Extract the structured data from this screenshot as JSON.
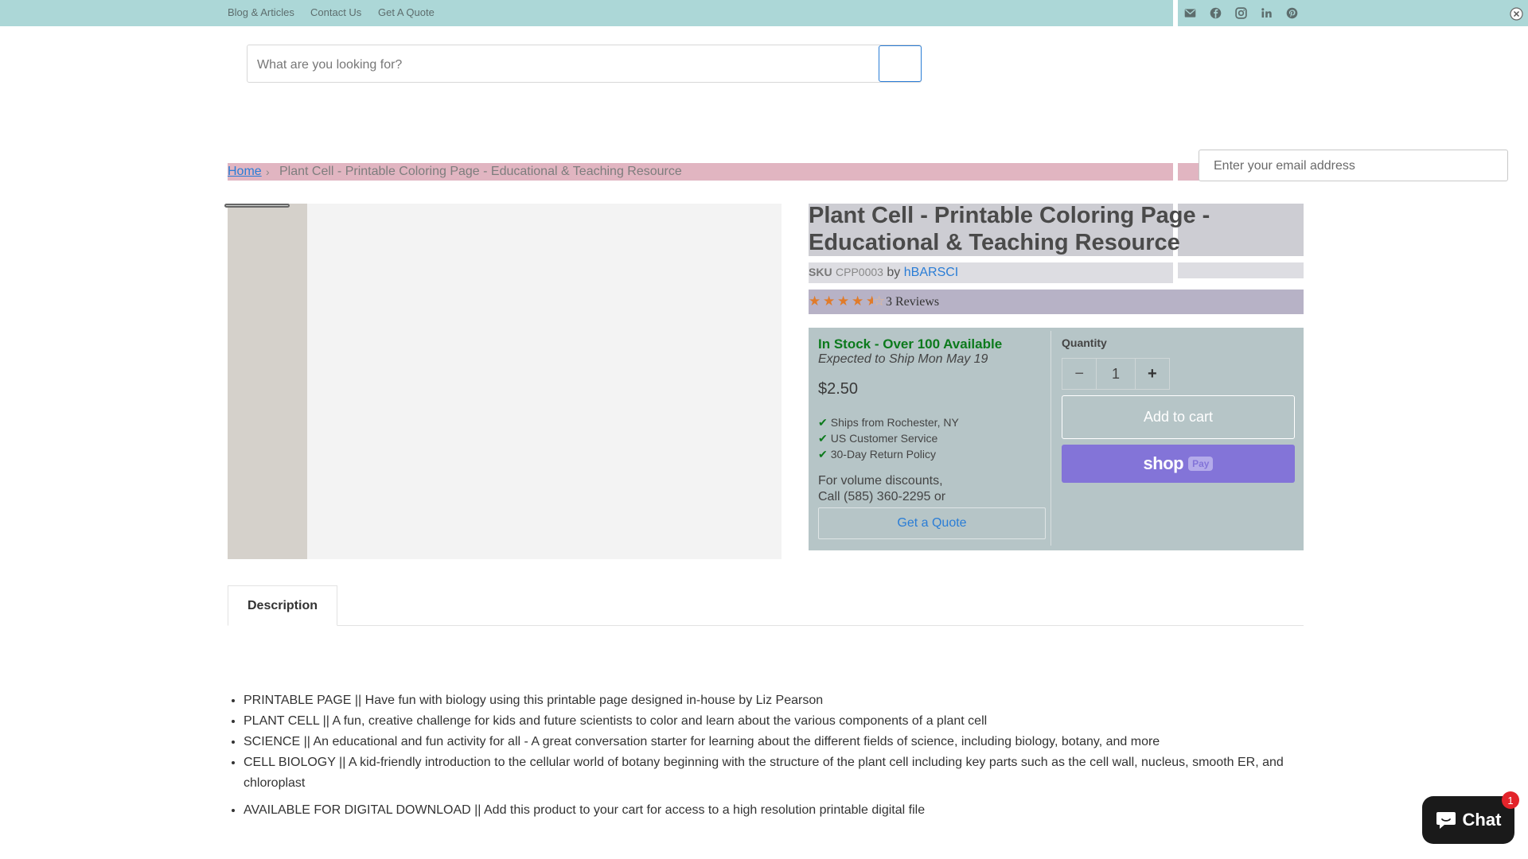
{
  "topbar": {
    "links": [
      "Blog & Articles",
      "Contact Us",
      "Get A Quote"
    ],
    "social_icons": [
      "email-icon",
      "facebook-icon",
      "instagram-icon",
      "linkedin-icon",
      "pinterest-icon"
    ]
  },
  "search": {
    "placeholder": "What are you looking for?"
  },
  "breadcrumb": {
    "home": "Home",
    "separator": "›",
    "current": "Plant Cell - Printable Coloring Page - Educational & Teaching Resource"
  },
  "email_popup": {
    "placeholder": "Enter your email address"
  },
  "product": {
    "title_line1": "Plant Cell - Printable Coloring Page -",
    "title_line2": "Educational & Teaching Resource",
    "sku_label": "SKU",
    "sku": "CPP0003",
    "by": "by",
    "vendor": "hBARSCI",
    "rating": 4.5,
    "reviews": "3 Reviews",
    "stock": "In Stock - Over 100 Available",
    "ship": "Expected to Ship Mon May 19",
    "price": "$2.50",
    "features": [
      "Ships from Rochester, NY",
      "US Customer Service",
      "30-Day Return Policy"
    ],
    "volume_line1": "For volume discounts,",
    "volume_line2": "Call (585) 360-2295 or",
    "quote_button": "Get a Quote",
    "quantity_label": "Quantity",
    "quantity": "1",
    "minus": "−",
    "plus": "+",
    "add_to_cart": "Add to cart",
    "shop_pay": "shop",
    "shop_pay_badge": "Pay"
  },
  "tabs": {
    "description": "Description"
  },
  "description": [
    "PRINTABLE PAGE || Have fun with biology using this printable page designed in-house by Liz Pearson",
    "PLANT CELL || A fun, creative challenge for kids and future scientists to color and learn about the various components of a plant cell",
    "SCIENCE || An educational and fun activity for all - A great conversation starter for learning about the different fields of science, including biology, botany, and more",
    "CELL BIOLOGY || A kid-friendly introduction to the cellular world of botany beginning with the structure of the plant cell including key parts such as the cell wall, nucleus, smooth ER, and chloroplast",
    "AVAILABLE FOR DIGITAL DOWNLOAD || Add this product to your cart for access to a high resolution printable digital file"
  ],
  "chat": {
    "label": "Chat",
    "badge": "1"
  },
  "colors": {
    "accent": "#2a7dd6",
    "stock": "#0c7a1c",
    "star": "#e07b2a",
    "shoppay": "#8374d8"
  }
}
